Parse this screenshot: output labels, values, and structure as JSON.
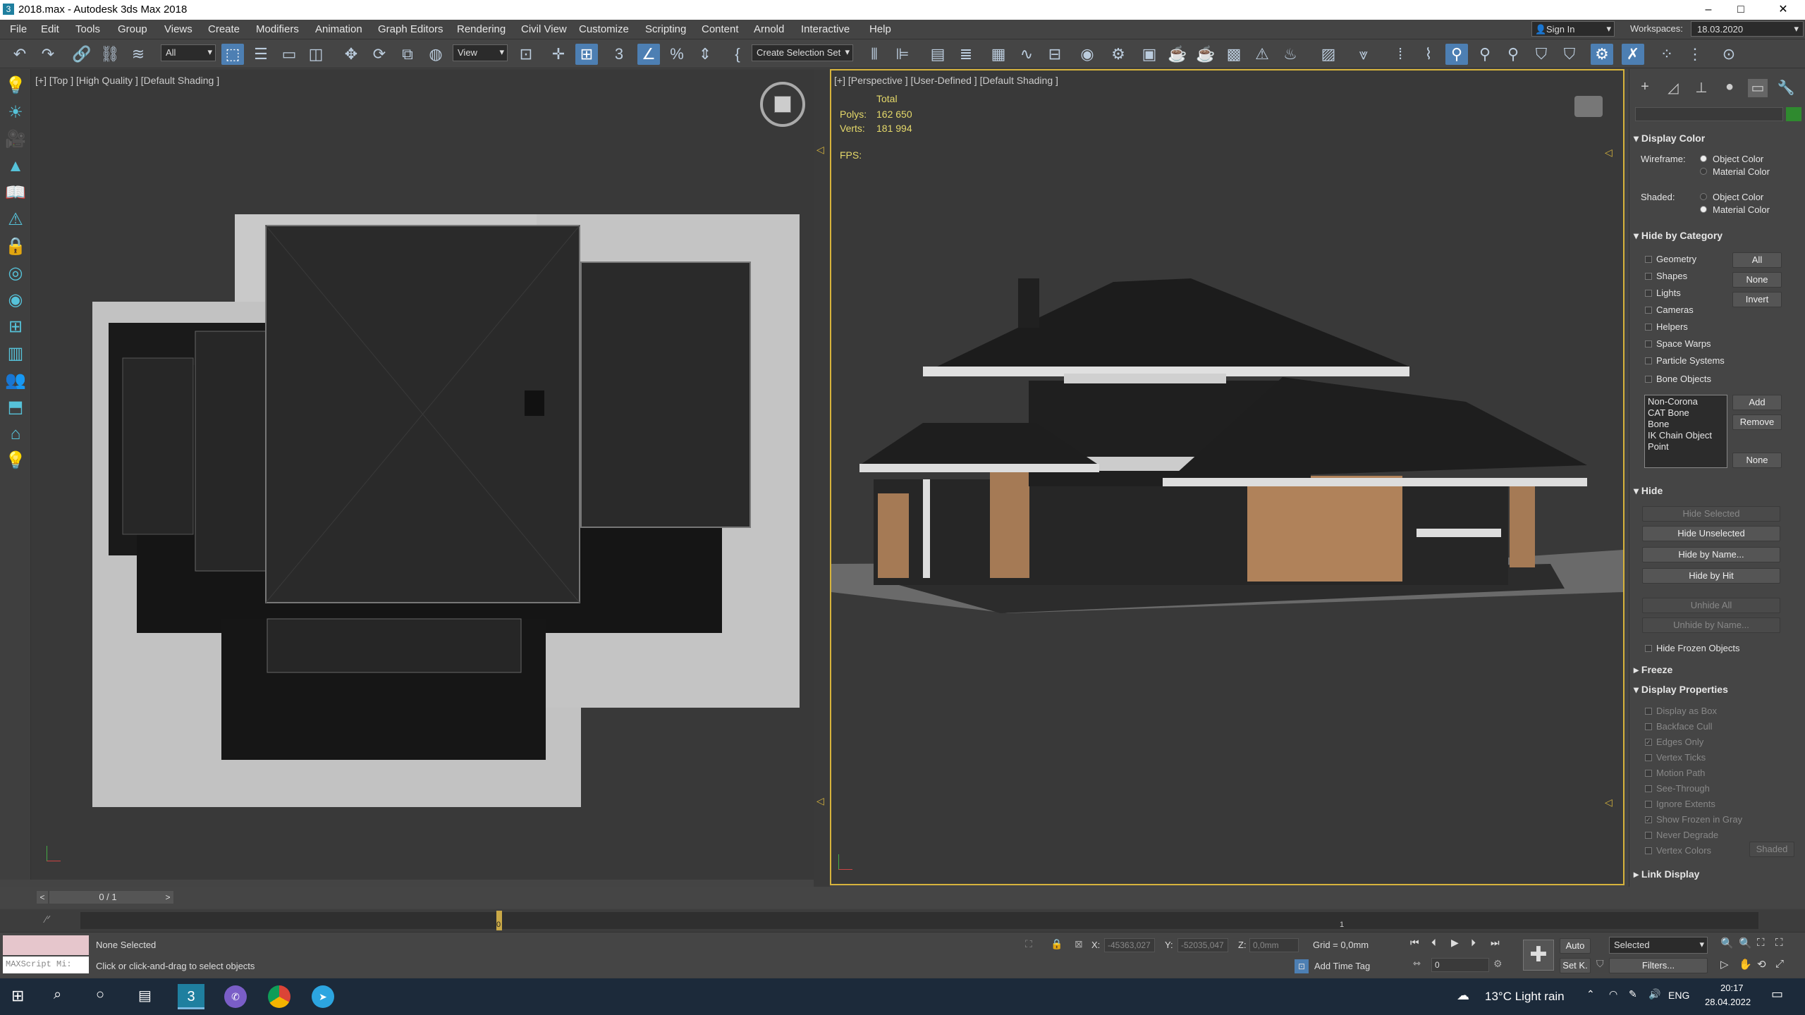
{
  "window": {
    "title": "2018.max - Autodesk 3ds Max 2018",
    "controls": [
      "–",
      "□",
      "✕"
    ]
  },
  "menu": [
    "File",
    "Edit",
    "Tools",
    "Group",
    "Views",
    "Create",
    "Modifiers",
    "Animation",
    "Graph Editors",
    "Rendering",
    "Civil View",
    "Customize",
    "Scripting",
    "Content",
    "Arnold",
    "Interactive",
    "Help"
  ],
  "account": {
    "signin": "Sign In",
    "workspaces_label": "Workspaces:",
    "workspace": "18.03.2020"
  },
  "toolbar": {
    "filter": "All",
    "refcoord": "View",
    "selection_set": "Create Selection Set"
  },
  "viewport_top": {
    "label": "[+] [Top ] [High Quality ] [Default Shading ]"
  },
  "viewport_persp": {
    "label": "[+] [Perspective ] [User-Defined ] [Default Shading ]",
    "stats": {
      "total": "Total",
      "polys_label": "Polys:",
      "polys": "162 650",
      "verts_label": "Verts:",
      "verts": "181 994",
      "fps_label": "FPS:"
    }
  },
  "panel": {
    "display_color": {
      "title": "Display Color",
      "wireframe": "Wireframe:",
      "shaded": "Shaded:",
      "object_color": "Object Color",
      "material_color": "Material Color"
    },
    "hide_by_category": {
      "title": "Hide by Category",
      "items": [
        "Geometry",
        "Shapes",
        "Lights",
        "Cameras",
        "Helpers",
        "Space Warps",
        "Particle Systems",
        "Bone Objects"
      ],
      "all": "All",
      "none": "None",
      "invert": "Invert",
      "list": [
        "Non-Corona",
        "CAT Bone",
        "Bone",
        "IK Chain Object",
        "Point"
      ],
      "add": "Add",
      "remove": "Remove",
      "none2": "None"
    },
    "hide": {
      "title": "Hide",
      "hide_selected": "Hide Selected",
      "hide_unselected": "Hide Unselected",
      "hide_by_name": "Hide by Name...",
      "hide_by_hit": "Hide by Hit",
      "unhide_all": "Unhide All",
      "unhide_by_name": "Unhide by Name...",
      "hide_frozen": "Hide Frozen Objects"
    },
    "freeze": {
      "title": "Freeze"
    },
    "display_props": {
      "title": "Display Properties",
      "items": [
        "Display as Box",
        "Backface Cull",
        "Edges Only",
        "Vertex Ticks",
        "Motion Path",
        "See-Through",
        "Ignore Extents",
        "Show Frozen in Gray",
        "Never Degrade",
        "Vertex Colors"
      ],
      "shaded": "Shaded"
    },
    "link_display": {
      "title": "Link Display"
    }
  },
  "timeline": {
    "frame": "0 / 1",
    "prev": "<",
    "next": ">",
    "curve_icon": "curve-editor-icon",
    "frame_marker": "0",
    "tick_1": "1"
  },
  "status": {
    "maxscript": "MAXScript Mi:",
    "selected": "None Selected",
    "hint": "Click or click-and-drag to select objects",
    "x_label": "X:",
    "x": "-45363,027",
    "y_label": "Y:",
    "y": "-52035,047",
    "z_label": "Z:",
    "z": "0,0mm",
    "grid": "Grid = 0,0mm",
    "add_time_tag": "Add Time Tag",
    "auto": "Auto",
    "setk": "Set K.",
    "selected_dd": "Selected",
    "filters": "Filters...",
    "frame_field": "0"
  },
  "taskbar": {
    "weather": "13°C  Light rain",
    "lang": "ENG",
    "time": "20:17",
    "date": "28.04.2022"
  },
  "colors": {
    "accent": "#d6b33c",
    "tool_active": "#4d7fb3",
    "stats": "#e5d96a",
    "icon": "#56c2d9"
  }
}
